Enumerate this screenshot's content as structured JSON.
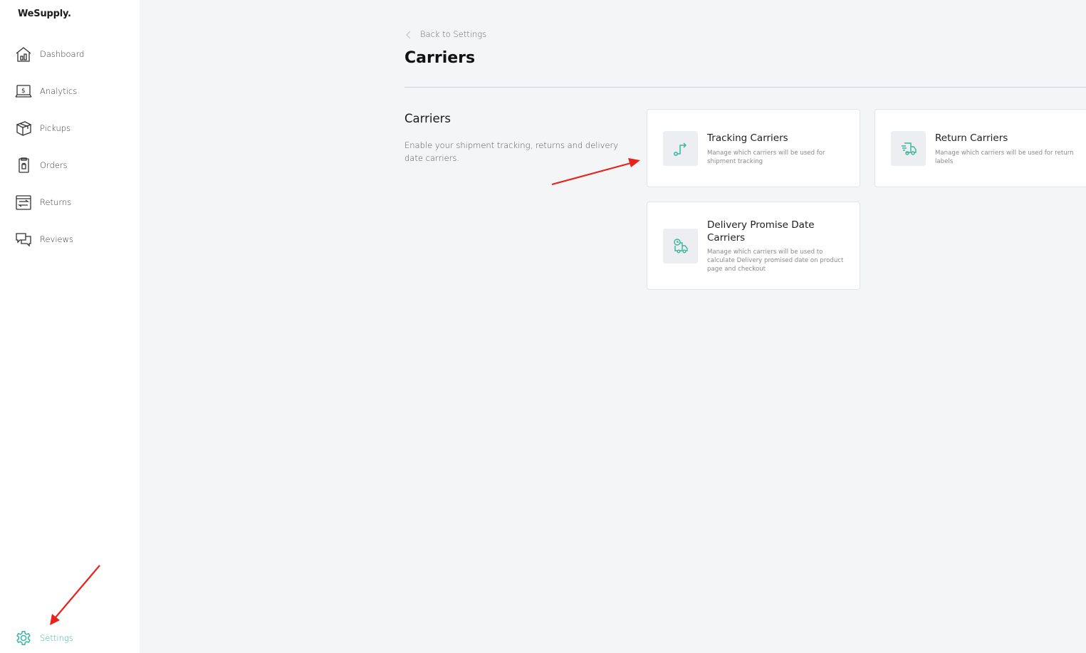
{
  "app": {
    "logo": "WeSupply."
  },
  "sidebar": {
    "items": [
      {
        "label": "Dashboard",
        "icon": "dashboard-icon"
      },
      {
        "label": "Analytics",
        "icon": "analytics-icon"
      },
      {
        "label": "Pickups",
        "icon": "box-icon"
      },
      {
        "label": "Orders",
        "icon": "clipboard-icon"
      },
      {
        "label": "Returns",
        "icon": "returns-icon"
      },
      {
        "label": "Reviews",
        "icon": "chat-icon"
      }
    ],
    "settings": {
      "label": "Settings",
      "icon": "gear-icon"
    }
  },
  "header": {
    "back_label": "Back to Settings",
    "title": "Carriers"
  },
  "section": {
    "title": "Carriers",
    "description": "Enable your shipment tracking, returns and delivery date carriers."
  },
  "cards": [
    {
      "title": "Tracking Carriers",
      "description": "Manage which carriers will be used for shipment tracking",
      "icon": "route-icon"
    },
    {
      "title": "Return Carriers",
      "description": "Manage which carriers will be used for return labels",
      "icon": "delivery-truck-icon"
    },
    {
      "title": "Delivery Promise Date Carriers",
      "description": "Manage which carriers will be used to calculate Delivery promised date on product page and checkout",
      "icon": "truck-clock-icon"
    }
  ],
  "colors": {
    "accent": "#36b69b",
    "annotation_arrow": "#e8231c"
  }
}
